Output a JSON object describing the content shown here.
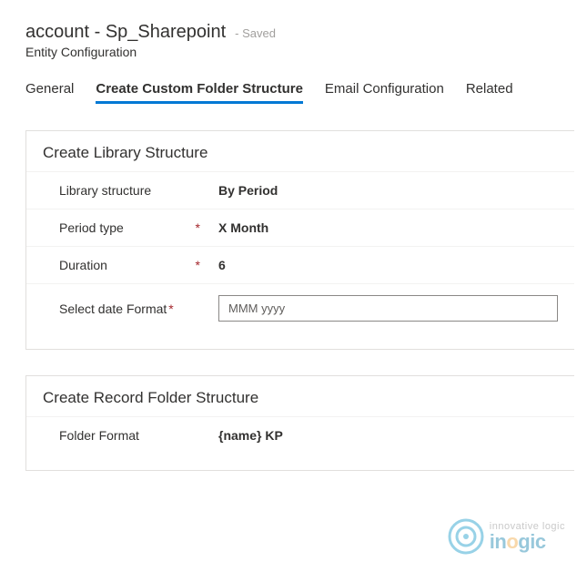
{
  "header": {
    "title": "account - Sp_Sharepoint",
    "saved": "- Saved",
    "subtitle": "Entity Configuration"
  },
  "tabs": {
    "general": "General",
    "create": "Create Custom Folder Structure",
    "email": "Email Configuration",
    "related": "Related"
  },
  "library": {
    "section_title": "Create Library Structure",
    "structure_label": "Library structure",
    "structure_value": "By Period",
    "period_label": "Period type",
    "period_value": "X Month",
    "duration_label": "Duration",
    "duration_value": "6",
    "dateformat_label": "Select date Format",
    "dateformat_value": "MMM yyyy",
    "required": "*"
  },
  "record": {
    "section_title": "Create Record Folder Structure",
    "format_label": "Folder Format",
    "format_value": "{name} KP"
  },
  "watermark": {
    "top": "innovative logic",
    "bottom_pre": "in",
    "bottom_o": "o",
    "bottom_post": "gic"
  }
}
